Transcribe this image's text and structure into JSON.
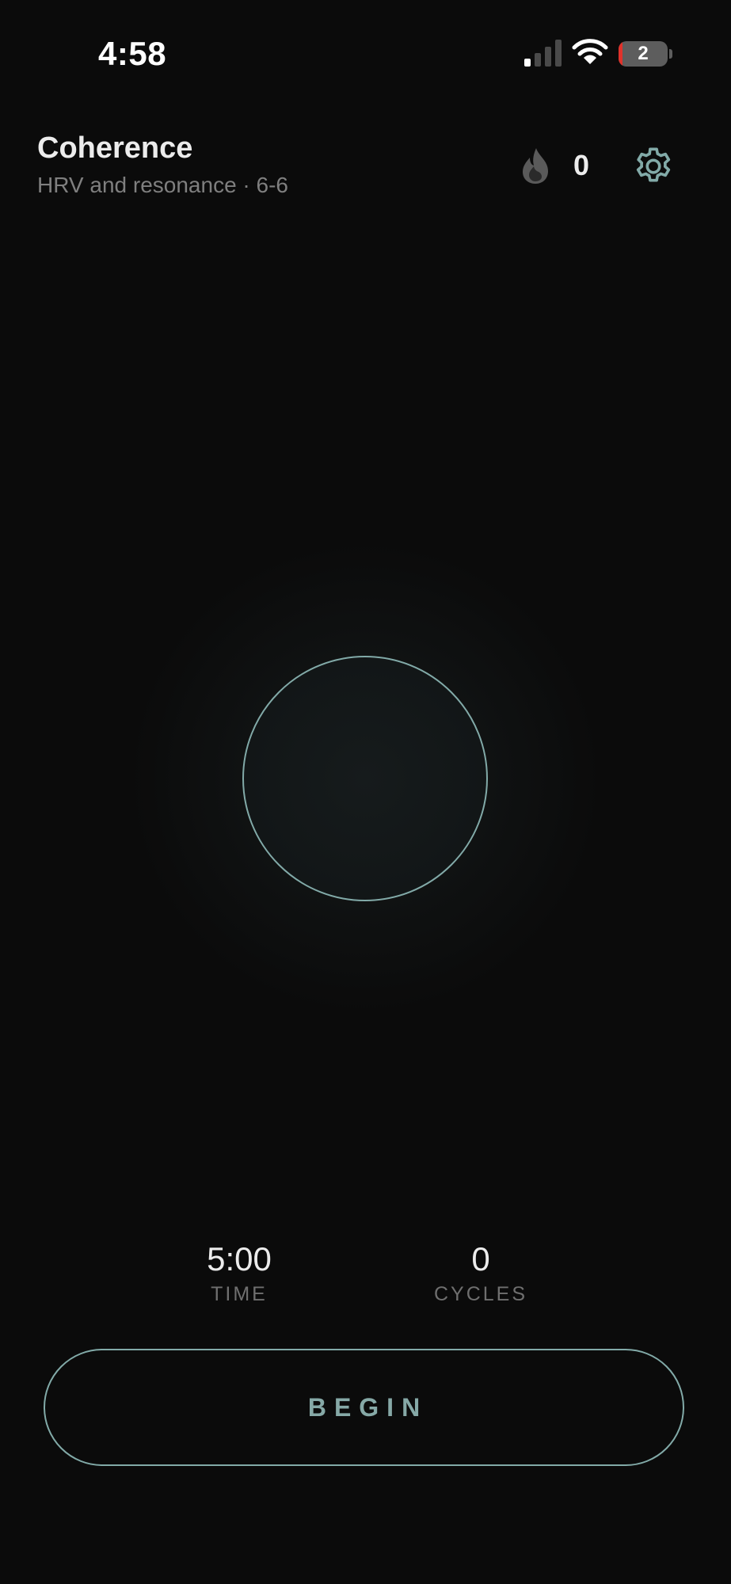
{
  "status_bar": {
    "time": "4:58",
    "battery_level": "2",
    "icons": [
      "signal-icon",
      "wifi-icon",
      "battery-icon"
    ]
  },
  "header": {
    "title": "Coherence",
    "subtitle": "HRV and resonance · 6-6",
    "streak_count": "0",
    "icons": [
      "flame-icon",
      "gear-icon"
    ]
  },
  "stats": {
    "time_value": "5:00",
    "time_label": "TIME",
    "cycles_value": "0",
    "cycles_label": "CYCLES"
  },
  "begin_button": {
    "label": "BEGIN"
  },
  "colors": {
    "background": "#0b0b0b",
    "accent": "#82aaa8",
    "text_primary": "#ececec",
    "text_secondary": "#7f7f7f",
    "battery_low": "#e0322b"
  }
}
